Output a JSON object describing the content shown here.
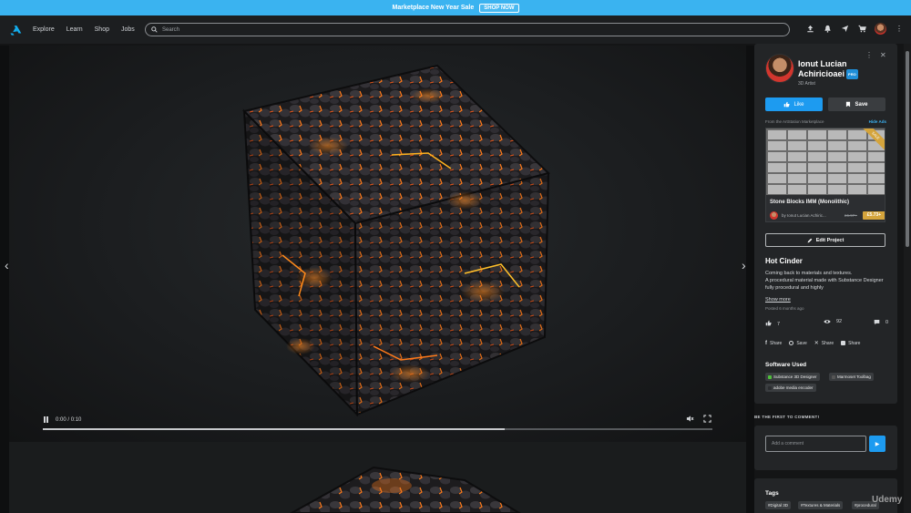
{
  "banner": {
    "text": "Marketplace New Year Sale",
    "button": "SHOP NOW"
  },
  "nav": {
    "links": [
      "Explore",
      "Learn",
      "Shop",
      "Jobs"
    ],
    "search_placeholder": "Search"
  },
  "video": {
    "current_time": "0:00",
    "separator": "/",
    "duration": "0:10",
    "progress": 0.69
  },
  "artist": {
    "name": "Ionut Lucian Achiricioaei",
    "badge": "PRO",
    "role": "3D Artist"
  },
  "actions": {
    "like": "Like",
    "save": "Save"
  },
  "ad": {
    "label": "From the ArtStation Marketplace",
    "hide": "Hide Ads",
    "ribbon": "SALE",
    "title": "Stone Blocks IMM (Monolithic)",
    "author": "by Ionut Lucian Achiric...",
    "old_price": "£6.97+",
    "price": "£5.73+"
  },
  "edit_project": "Edit Project",
  "project": {
    "title": "Hot Cinder",
    "description": "Coming back to materials and textures.\nA procedural material made with Substance Designer fully procedural and highly",
    "show_more": "Show more",
    "posted": "Posted 6 months ago"
  },
  "stats": {
    "likes": "7",
    "views": "92",
    "comments": "0"
  },
  "share": [
    "Share",
    "Save",
    "Share",
    "Share"
  ],
  "software": {
    "title": "Software Used",
    "items": [
      "Substance 3D Designer",
      "Marmoset Toolbag",
      "adobe media encoder"
    ]
  },
  "comments": {
    "heading": "BE THE FIRST TO COMMENT!",
    "placeholder": "Add a comment"
  },
  "tags": {
    "title": "Tags",
    "items": [
      "#Digital 3D",
      "#Textures & Materials",
      "#procedural"
    ]
  },
  "watermark": "Udemy",
  "colors": {
    "accent": "#1d9bf0",
    "banner": "#3ab3f0",
    "sale": "#d4a43c",
    "ember": "#ff7a1a"
  }
}
